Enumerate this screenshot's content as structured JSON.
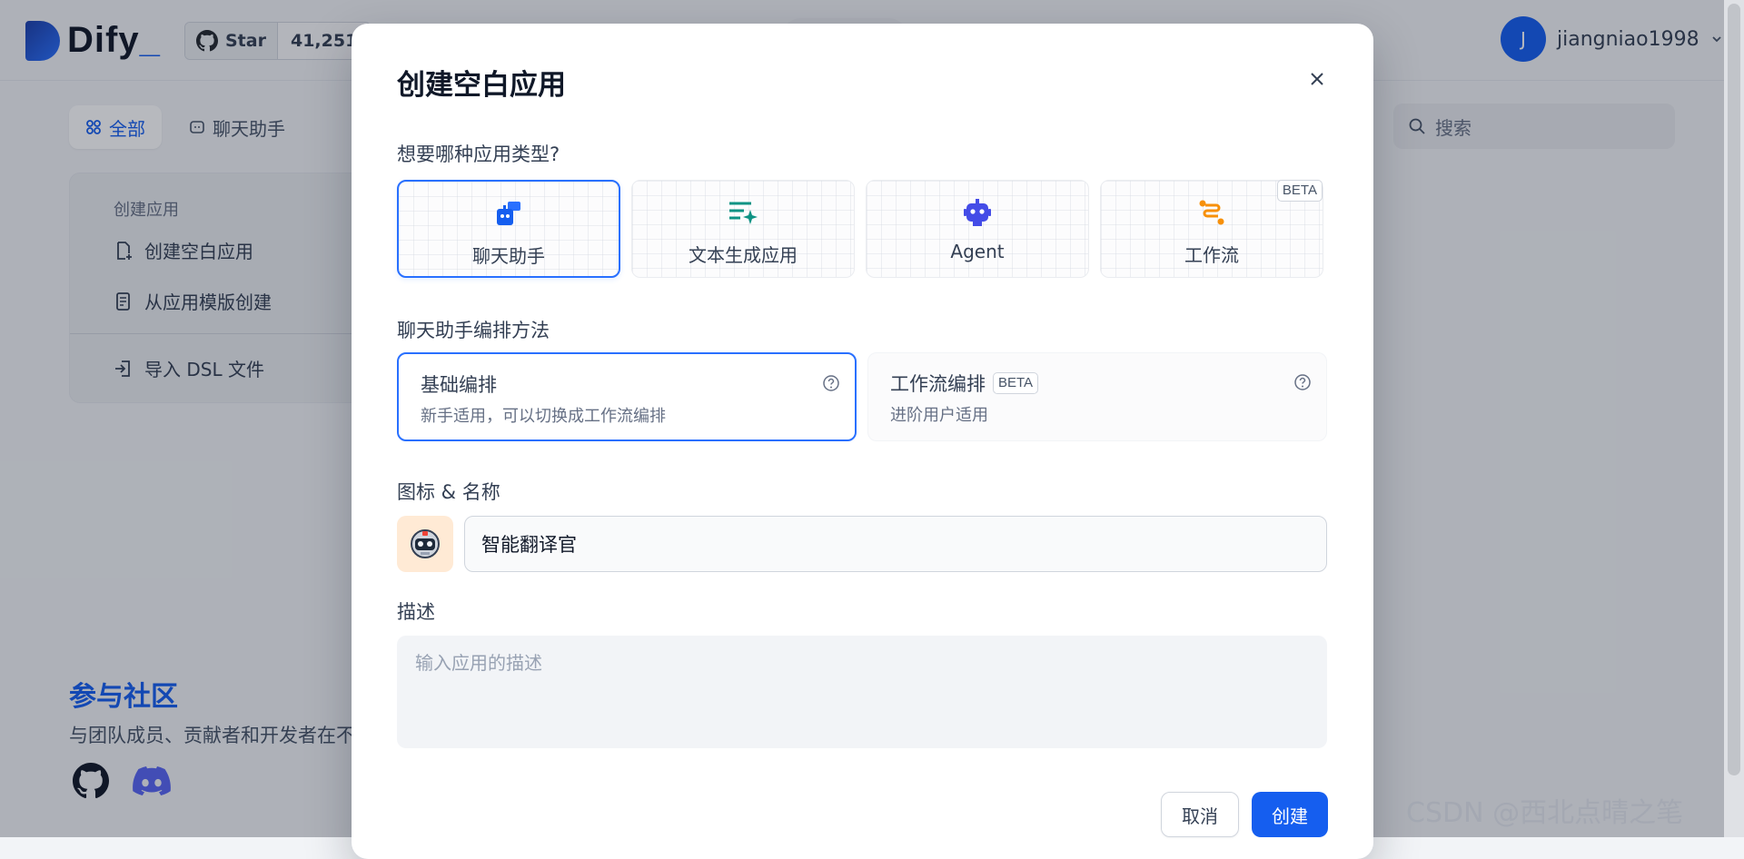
{
  "header": {
    "logo_text": "Dify",
    "logo_suffix": "_",
    "github_star_label": "Star",
    "github_star_count": "41,251",
    "user_initial": "J",
    "user_name": "jiangniao1998"
  },
  "tabs": [
    {
      "label": "全部",
      "active": true
    },
    {
      "label": "聊天助手",
      "active": false
    }
  ],
  "search": {
    "placeholder": "搜索"
  },
  "create_panel": {
    "heading": "创建应用",
    "items": [
      {
        "label": "创建空白应用"
      },
      {
        "label": "从应用模版创建"
      },
      {
        "label": "导入 DSL 文件"
      }
    ]
  },
  "community": {
    "title": "参与社区",
    "desc": "与团队成员、贡献者和开发者在不"
  },
  "modal": {
    "title": "创建空白应用",
    "type_question": "想要哪种应用类型?",
    "types": [
      {
        "label": "聊天助手",
        "icon": "chat-bot-icon",
        "selected": true
      },
      {
        "label": "文本生成应用",
        "icon": "text-generation-icon",
        "selected": false
      },
      {
        "label": "Agent",
        "icon": "agent-robot-icon",
        "selected": false
      },
      {
        "label": "工作流",
        "icon": "workflow-icon",
        "selected": false,
        "badge": "BETA"
      }
    ],
    "mode_label": "聊天助手编排方法",
    "modes": [
      {
        "title": "基础编排",
        "desc": "新手适用，可以切换成工作流编排",
        "selected": true
      },
      {
        "title": "工作流编排",
        "badge": "BETA",
        "desc": "进阶用户适用",
        "selected": false
      }
    ],
    "name_label": "图标 & 名称",
    "name_value": "智能翻译官",
    "icon_emoji": "robot-icon",
    "desc_label": "描述",
    "desc_placeholder": "输入应用的描述",
    "cancel_label": "取消",
    "create_label": "创建"
  },
  "watermark": "CSDN @西北点晴之笔",
  "colors": {
    "accent": "#155eef",
    "icon_bg": "#ffead5"
  }
}
